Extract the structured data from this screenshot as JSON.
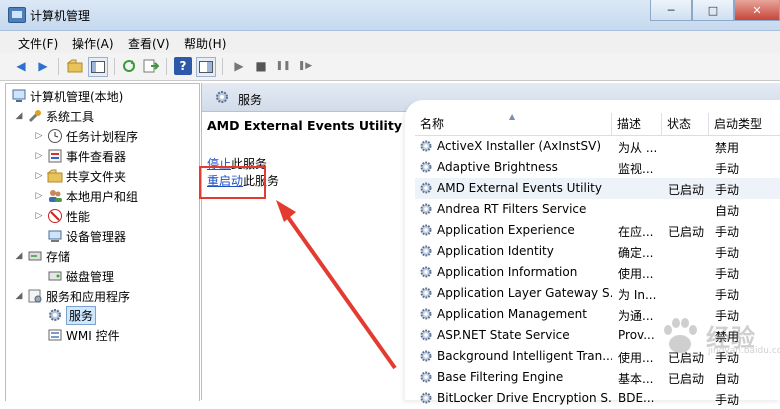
{
  "window": {
    "title": "计算机管理",
    "min": "─",
    "max": "□",
    "close": "✕"
  },
  "menu": [
    "文件(F)",
    "操作(A)",
    "查看(V)",
    "帮助(H)"
  ],
  "toolbar": {
    "back": "◀",
    "forward": "▶",
    "play": "▶",
    "stop": "■",
    "pause": "❚❚",
    "restart": "❚▶",
    "help": "?"
  },
  "tree": {
    "root": "计算机管理(本地)",
    "system_tools": "系统工具",
    "task_scheduler": "任务计划程序",
    "event_viewer": "事件查看器",
    "shared_folders": "共享文件夹",
    "local_users": "本地用户和组",
    "performance": "性能",
    "device_manager": "设备管理器",
    "storage": "存储",
    "disk_management": "磁盘管理",
    "services_apps": "服务和应用程序",
    "services": "服务",
    "wmi": "WMI 控件"
  },
  "services_panel": {
    "header": "服务",
    "selected_service": "AMD External Events Utility",
    "stop_link": "停止",
    "stop_suffix": "此服务",
    "restart_link": "重启动",
    "restart_suffix": "此服务"
  },
  "columns": {
    "name": "名称",
    "desc": "描述",
    "status": "状态",
    "startup": "启动类型"
  },
  "rows": [
    {
      "name": "ActiveX Installer (AxInstSV)",
      "desc": "为从 ...",
      "status": "",
      "startup": "禁用"
    },
    {
      "name": "Adaptive Brightness",
      "desc": "监视...",
      "status": "",
      "startup": "手动"
    },
    {
      "name": "AMD External Events Utility",
      "desc": "",
      "status": "已启动",
      "startup": "手动"
    },
    {
      "name": "Andrea RT Filters Service",
      "desc": "",
      "status": "",
      "startup": "自动"
    },
    {
      "name": "Application Experience",
      "desc": "在应...",
      "status": "已启动",
      "startup": "手动"
    },
    {
      "name": "Application Identity",
      "desc": "确定...",
      "status": "",
      "startup": "手动"
    },
    {
      "name": "Application Information",
      "desc": "使用...",
      "status": "",
      "startup": "手动"
    },
    {
      "name": "Application Layer Gateway S...",
      "desc": "为 In...",
      "status": "",
      "startup": "手动"
    },
    {
      "name": "Application Management",
      "desc": "为通...",
      "status": "",
      "startup": "手动"
    },
    {
      "name": "ASP.NET State Service",
      "desc": "Prov...",
      "status": "",
      "startup": "禁用"
    },
    {
      "name": "Background Intelligent Tran...",
      "desc": "使用...",
      "status": "已启动",
      "startup": "手动"
    },
    {
      "name": "Base Filtering Engine",
      "desc": "基本...",
      "status": "已启动",
      "startup": "自动"
    },
    {
      "name": "BitLocker Drive Encryption S...",
      "desc": "BDE...",
      "status": "",
      "startup": "手动"
    }
  ],
  "watermark": {
    "text": "经验",
    "sub": "jingyan.baidu.com"
  },
  "colors": {
    "accent": "#1c4fc4",
    "highlight_box": "#e33b2f",
    "selected_bg": "#cde8ff"
  }
}
